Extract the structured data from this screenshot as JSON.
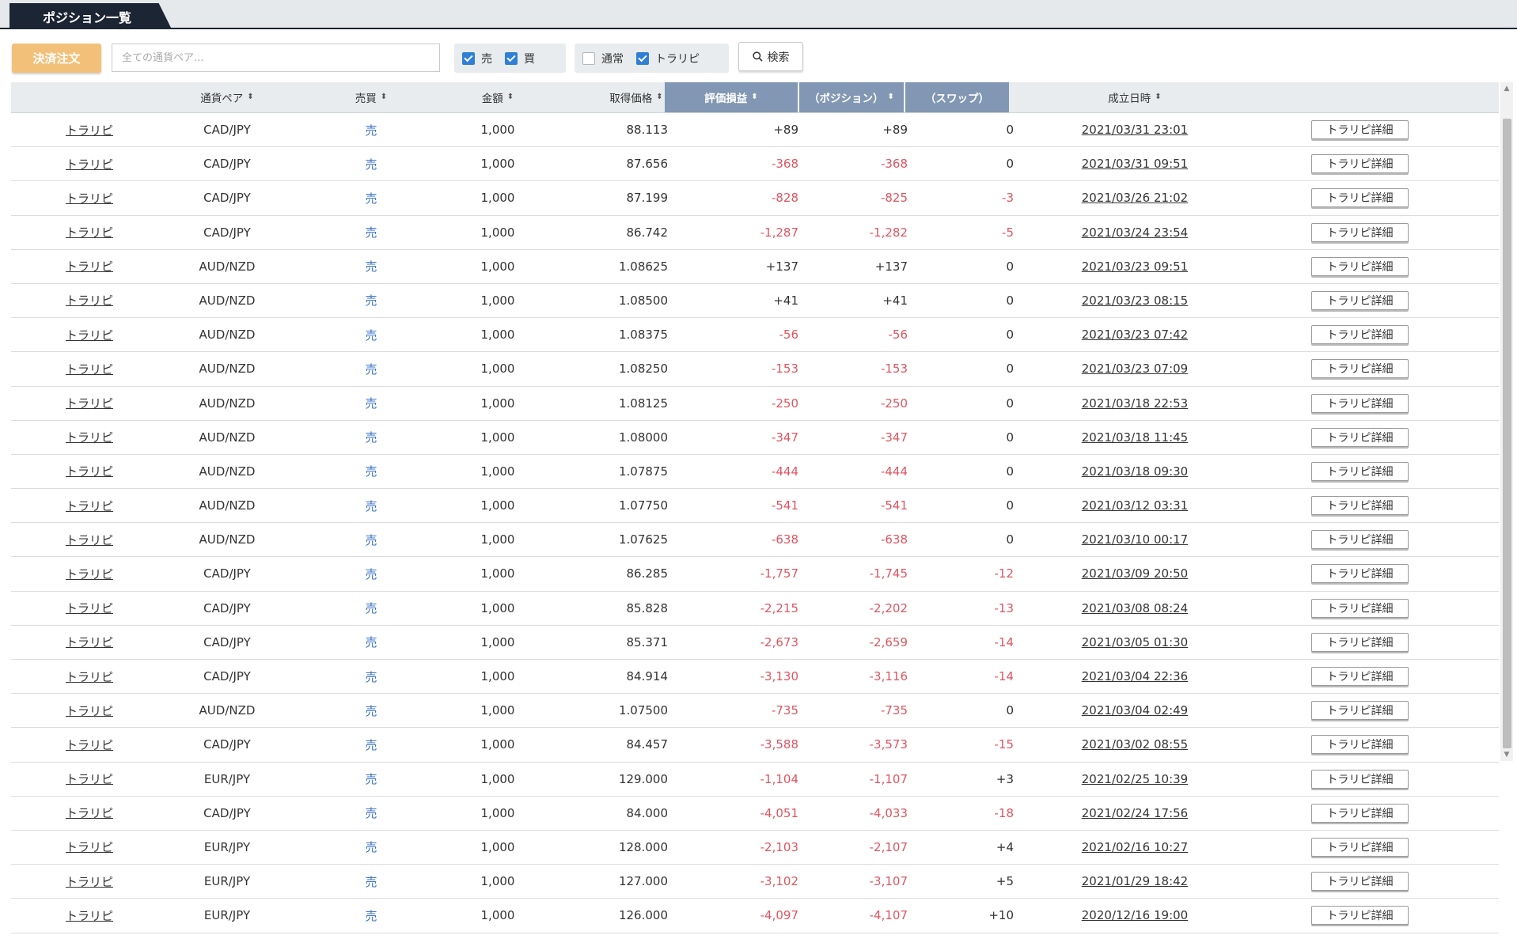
{
  "tab": {
    "label": "ポジション一覧"
  },
  "toolbar": {
    "settle_button": "決済注文",
    "pair_placeholder": "全ての通貨ペア...",
    "side_filters": [
      {
        "label": "売",
        "checked": true
      },
      {
        "label": "買",
        "checked": true
      }
    ],
    "type_filters": [
      {
        "label": "通常",
        "checked": false
      },
      {
        "label": "トラリピ",
        "checked": true
      }
    ],
    "search_button": "検索"
  },
  "table": {
    "columns": [
      "",
      "通貨ペア",
      "売買",
      "金額",
      "取得価格",
      "評価損益",
      "（ポジション）",
      "（スワップ）",
      "成立日時",
      ""
    ],
    "active_sort_column": "評価損益",
    "detail_button_label": "トラリピ詳細",
    "rows": [
      {
        "type": "トラリピ",
        "pair": "CAD/JPY",
        "side": "売",
        "amount": "1,000",
        "price": "88.113",
        "pnl": "+89",
        "position": "+89",
        "swap": "0",
        "datetime": "2021/03/31 23:01"
      },
      {
        "type": "トラリピ",
        "pair": "CAD/JPY",
        "side": "売",
        "amount": "1,000",
        "price": "87.656",
        "pnl": "-368",
        "position": "-368",
        "swap": "0",
        "datetime": "2021/03/31 09:51"
      },
      {
        "type": "トラリピ",
        "pair": "CAD/JPY",
        "side": "売",
        "amount": "1,000",
        "price": "87.199",
        "pnl": "-828",
        "position": "-825",
        "swap": "-3",
        "datetime": "2021/03/26 21:02"
      },
      {
        "type": "トラリピ",
        "pair": "CAD/JPY",
        "side": "売",
        "amount": "1,000",
        "price": "86.742",
        "pnl": "-1,287",
        "position": "-1,282",
        "swap": "-5",
        "datetime": "2021/03/24 23:54"
      },
      {
        "type": "トラリピ",
        "pair": "AUD/NZD",
        "side": "売",
        "amount": "1,000",
        "price": "1.08625",
        "pnl": "+137",
        "position": "+137",
        "swap": "0",
        "datetime": "2021/03/23 09:51"
      },
      {
        "type": "トラリピ",
        "pair": "AUD/NZD",
        "side": "売",
        "amount": "1,000",
        "price": "1.08500",
        "pnl": "+41",
        "position": "+41",
        "swap": "0",
        "datetime": "2021/03/23 08:15"
      },
      {
        "type": "トラリピ",
        "pair": "AUD/NZD",
        "side": "売",
        "amount": "1,000",
        "price": "1.08375",
        "pnl": "-56",
        "position": "-56",
        "swap": "0",
        "datetime": "2021/03/23 07:42"
      },
      {
        "type": "トラリピ",
        "pair": "AUD/NZD",
        "side": "売",
        "amount": "1,000",
        "price": "1.08250",
        "pnl": "-153",
        "position": "-153",
        "swap": "0",
        "datetime": "2021/03/23 07:09"
      },
      {
        "type": "トラリピ",
        "pair": "AUD/NZD",
        "side": "売",
        "amount": "1,000",
        "price": "1.08125",
        "pnl": "-250",
        "position": "-250",
        "swap": "0",
        "datetime": "2021/03/18 22:53"
      },
      {
        "type": "トラリピ",
        "pair": "AUD/NZD",
        "side": "売",
        "amount": "1,000",
        "price": "1.08000",
        "pnl": "-347",
        "position": "-347",
        "swap": "0",
        "datetime": "2021/03/18 11:45"
      },
      {
        "type": "トラリピ",
        "pair": "AUD/NZD",
        "side": "売",
        "amount": "1,000",
        "price": "1.07875",
        "pnl": "-444",
        "position": "-444",
        "swap": "0",
        "datetime": "2021/03/18 09:30"
      },
      {
        "type": "トラリピ",
        "pair": "AUD/NZD",
        "side": "売",
        "amount": "1,000",
        "price": "1.07750",
        "pnl": "-541",
        "position": "-541",
        "swap": "0",
        "datetime": "2021/03/12 03:31"
      },
      {
        "type": "トラリピ",
        "pair": "AUD/NZD",
        "side": "売",
        "amount": "1,000",
        "price": "1.07625",
        "pnl": "-638",
        "position": "-638",
        "swap": "0",
        "datetime": "2021/03/10 00:17"
      },
      {
        "type": "トラリピ",
        "pair": "CAD/JPY",
        "side": "売",
        "amount": "1,000",
        "price": "86.285",
        "pnl": "-1,757",
        "position": "-1,745",
        "swap": "-12",
        "datetime": "2021/03/09 20:50"
      },
      {
        "type": "トラリピ",
        "pair": "CAD/JPY",
        "side": "売",
        "amount": "1,000",
        "price": "85.828",
        "pnl": "-2,215",
        "position": "-2,202",
        "swap": "-13",
        "datetime": "2021/03/08 08:24"
      },
      {
        "type": "トラリピ",
        "pair": "CAD/JPY",
        "side": "売",
        "amount": "1,000",
        "price": "85.371",
        "pnl": "-2,673",
        "position": "-2,659",
        "swap": "-14",
        "datetime": "2021/03/05 01:30"
      },
      {
        "type": "トラリピ",
        "pair": "CAD/JPY",
        "side": "売",
        "amount": "1,000",
        "price": "84.914",
        "pnl": "-3,130",
        "position": "-3,116",
        "swap": "-14",
        "datetime": "2021/03/04 22:36"
      },
      {
        "type": "トラリピ",
        "pair": "AUD/NZD",
        "side": "売",
        "amount": "1,000",
        "price": "1.07500",
        "pnl": "-735",
        "position": "-735",
        "swap": "0",
        "datetime": "2021/03/04 02:49"
      },
      {
        "type": "トラリピ",
        "pair": "CAD/JPY",
        "side": "売",
        "amount": "1,000",
        "price": "84.457",
        "pnl": "-3,588",
        "position": "-3,573",
        "swap": "-15",
        "datetime": "2021/03/02 08:55"
      },
      {
        "type": "トラリピ",
        "pair": "EUR/JPY",
        "side": "売",
        "amount": "1,000",
        "price": "129.000",
        "pnl": "-1,104",
        "position": "-1,107",
        "swap": "+3",
        "datetime": "2021/02/25 10:39"
      },
      {
        "type": "トラリピ",
        "pair": "CAD/JPY",
        "side": "売",
        "amount": "1,000",
        "price": "84.000",
        "pnl": "-4,051",
        "position": "-4,033",
        "swap": "-18",
        "datetime": "2021/02/24 17:56"
      },
      {
        "type": "トラリピ",
        "pair": "EUR/JPY",
        "side": "売",
        "amount": "1,000",
        "price": "128.000",
        "pnl": "-2,103",
        "position": "-2,107",
        "swap": "+4",
        "datetime": "2021/02/16 10:27"
      },
      {
        "type": "トラリピ",
        "pair": "EUR/JPY",
        "side": "売",
        "amount": "1,000",
        "price": "127.000",
        "pnl": "-3,102",
        "position": "-3,107",
        "swap": "+5",
        "datetime": "2021/01/29 18:42"
      },
      {
        "type": "トラリピ",
        "pair": "EUR/JPY",
        "side": "売",
        "amount": "1,000",
        "price": "126.000",
        "pnl": "-4,097",
        "position": "-4,107",
        "swap": "+10",
        "datetime": "2020/12/16 19:00"
      }
    ]
  },
  "colors": {
    "negative": "#e05561",
    "side_sell": "#3b73c6",
    "active_header": "#8197b3",
    "settle_button": "#f3c07a"
  },
  "icons": {
    "search": "search-icon",
    "sort": "sort-icon"
  }
}
